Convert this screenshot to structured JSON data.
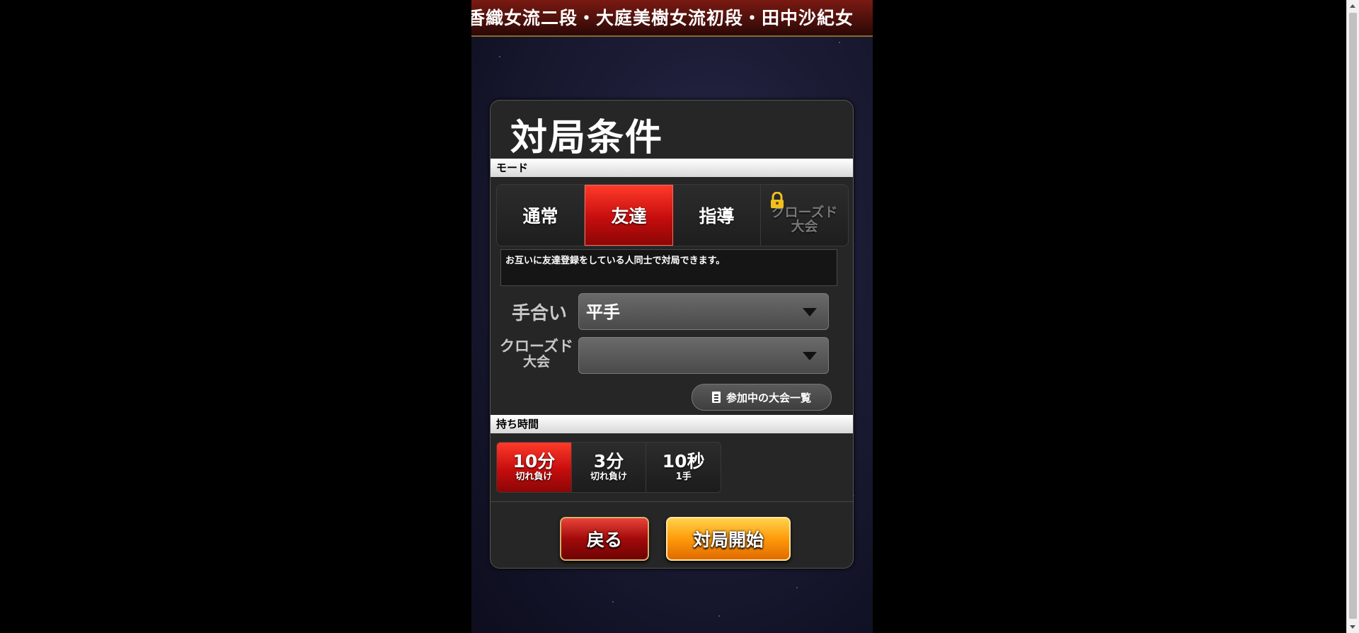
{
  "ticker": {
    "text": "香織女流二段・大庭美樹女流初段・田中沙紀女"
  },
  "panel": {
    "title": "対局条件",
    "mode_section_label": "モード",
    "modes": [
      {
        "label": "通常",
        "active": false
      },
      {
        "label": "友達",
        "active": true
      },
      {
        "label": "指導",
        "active": false
      },
      {
        "label_line1": "クローズド",
        "label_line2": "大会",
        "locked": true
      }
    ],
    "description": "お互いに友達登録をしている人同士で対局できます。",
    "handicap": {
      "label": "手合い",
      "value": "平手"
    },
    "closed_tournament": {
      "label_line1": "クローズド",
      "label_line2": "大会",
      "value": ""
    },
    "tournament_list_button": "参加中の大会一覧",
    "time_section_label": "持ち時間",
    "time_options": [
      {
        "main": "10分",
        "sub": "切れ負け",
        "active": true
      },
      {
        "main": "3分",
        "sub": "切れ負け",
        "active": false
      },
      {
        "main": "10秒",
        "sub": "1手",
        "active": false
      }
    ],
    "back_button": "戻る",
    "start_button": "対局開始"
  },
  "colors": {
    "active_red": "#c50d0d",
    "start_orange": "#ff9a0a",
    "lock_gold": "#f0c020"
  }
}
